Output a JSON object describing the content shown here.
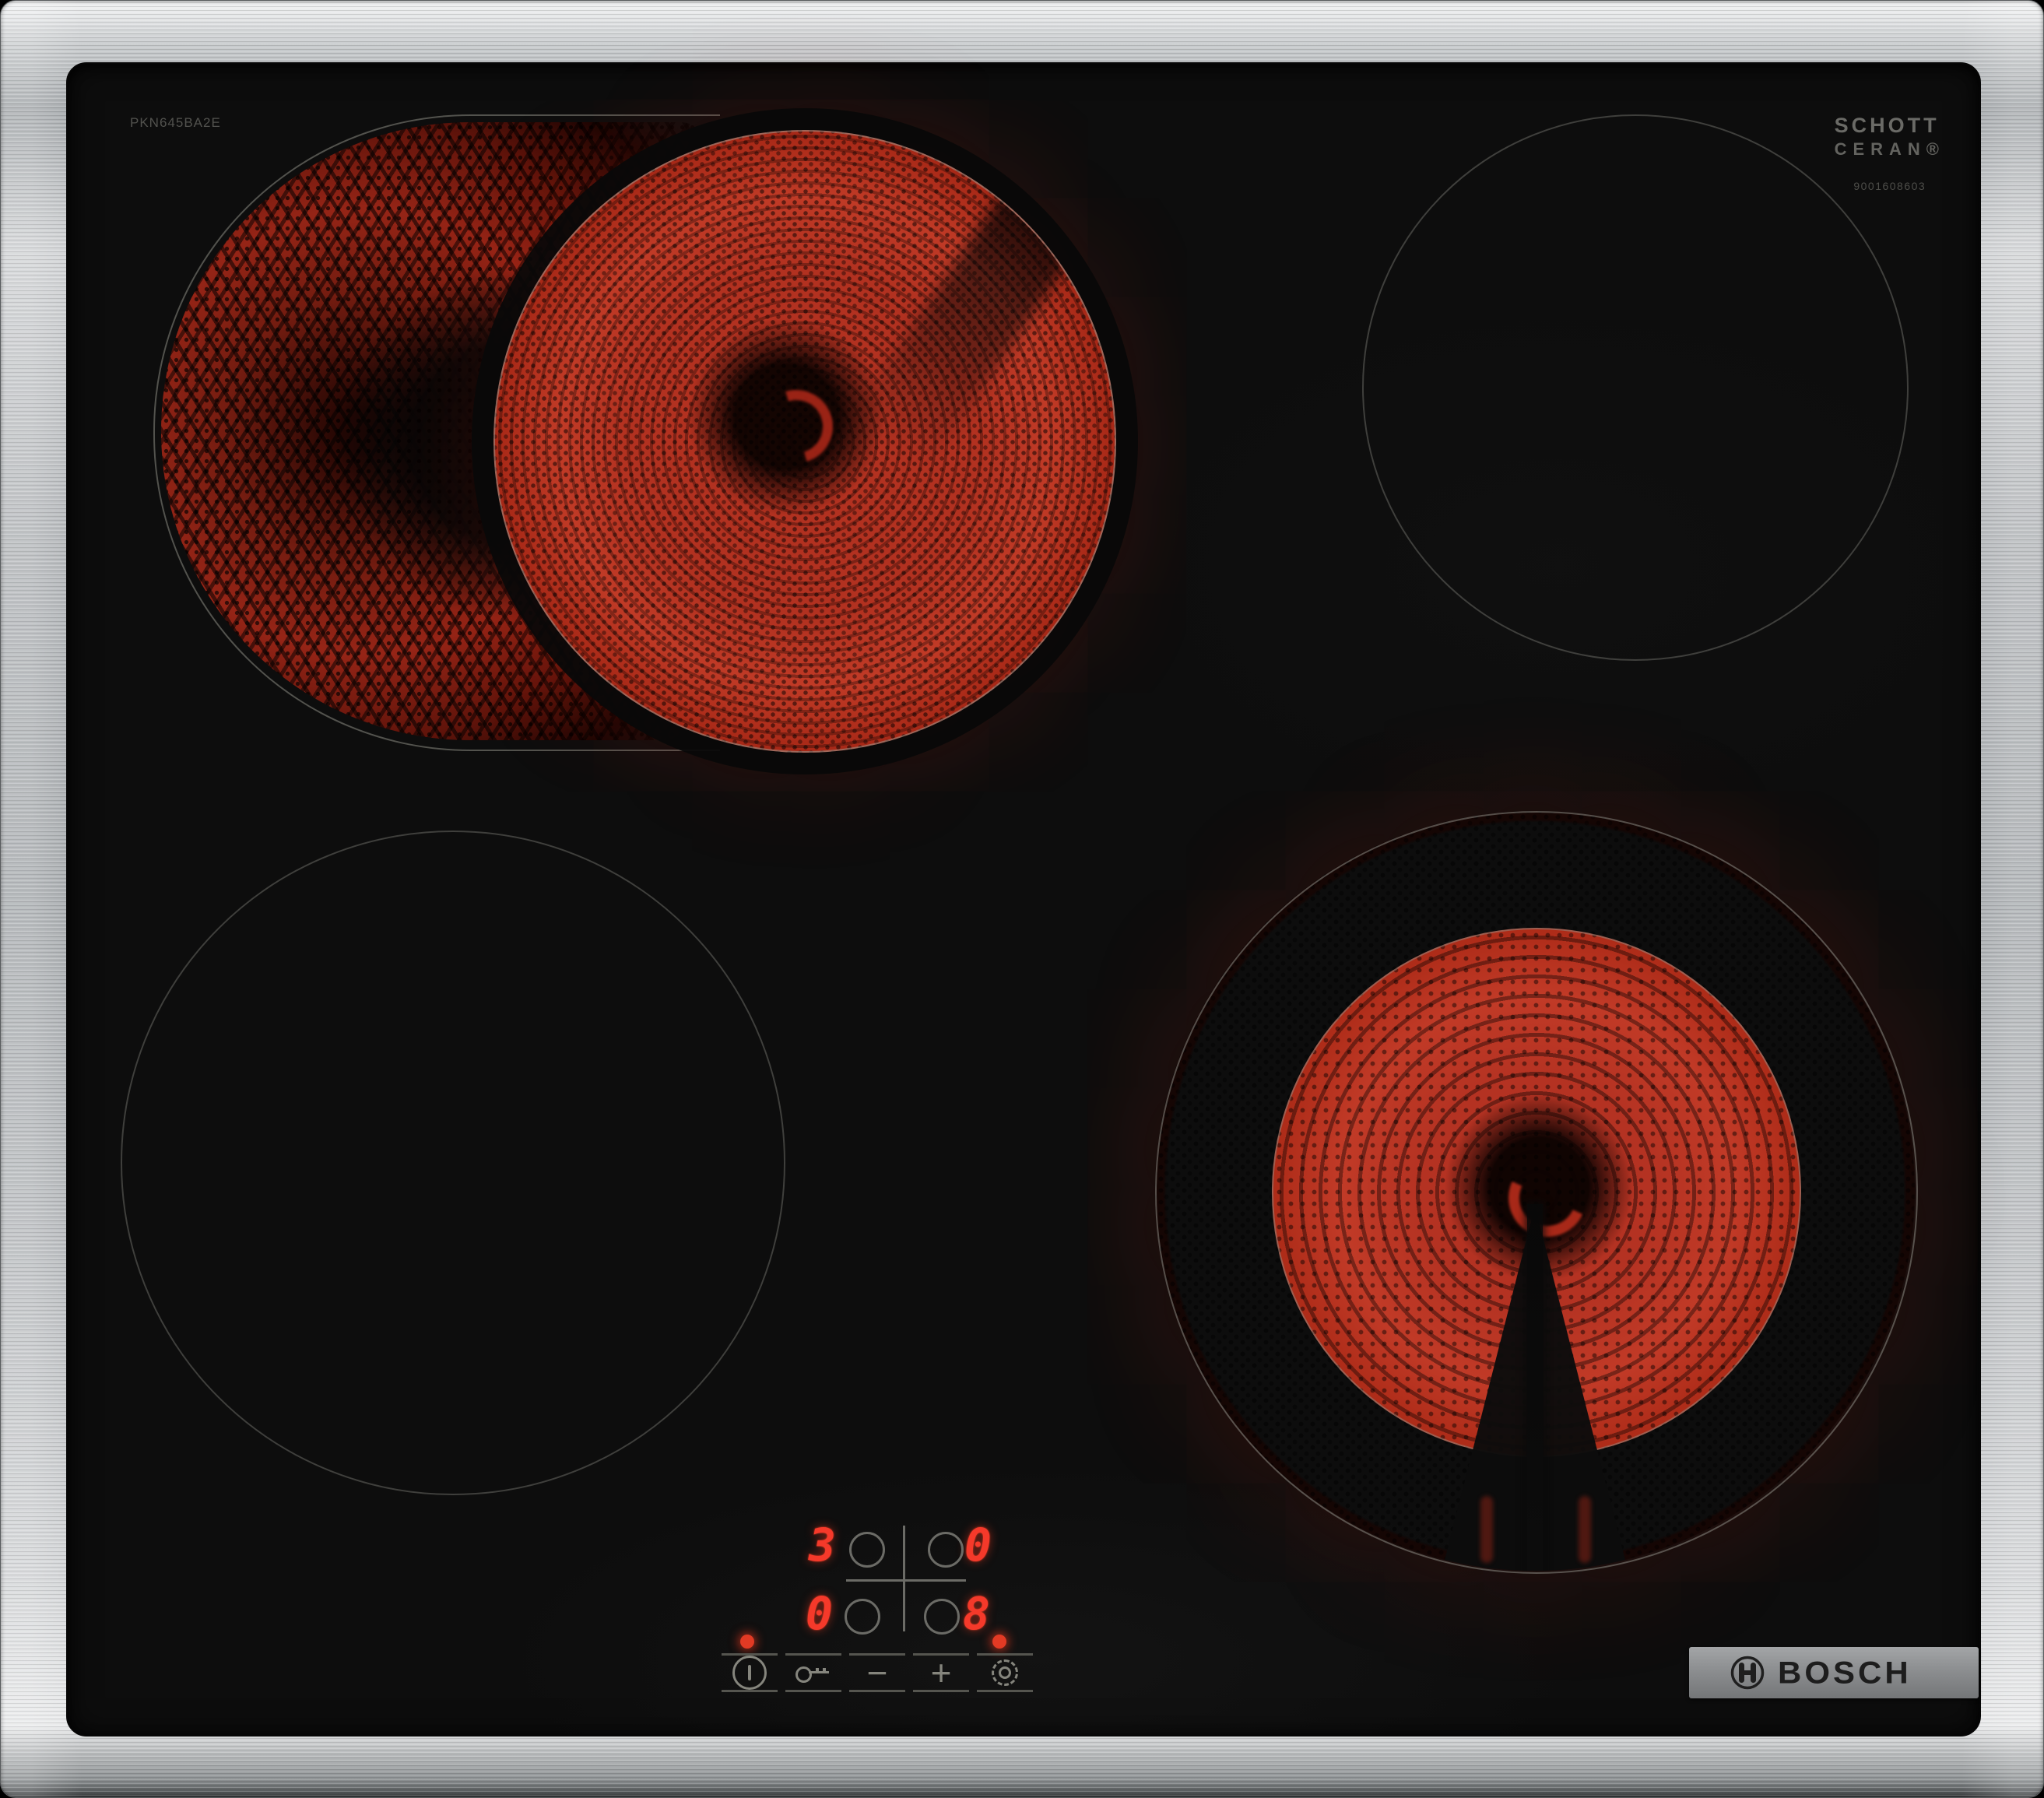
{
  "device": {
    "model": "PKN645BA2E",
    "glass_brand_line1": "SCHOTT",
    "glass_brand_line2": "CERAN®",
    "serial": "9001608603",
    "brand": "BOSCH"
  },
  "display": {
    "zone_levels": {
      "rear_left": "3",
      "rear_right": "0",
      "front_left": "0",
      "front_right": "8"
    }
  },
  "controls": {
    "power": "power-standby",
    "child_lock": "child-lock-key",
    "decrease_label": "−",
    "increase_label": "+",
    "dual_zone": "dual-zone-select",
    "residual_heat_left_on": true,
    "residual_heat_right_on": true
  },
  "burners": {
    "rear_left": {
      "type": "dual-circuit oval zone",
      "state": "on",
      "level": "3"
    },
    "rear_right": {
      "type": "single zone",
      "state": "off",
      "level": "0"
    },
    "front_left": {
      "type": "single zone",
      "state": "off",
      "level": "0"
    },
    "front_right": {
      "type": "dual-ring zone",
      "state": "on",
      "level": "8"
    }
  },
  "colors": {
    "frame_steel": "#b5b8bb",
    "glass": "#0d0d0d",
    "heat_red": "#c03a26",
    "outline_gray": "#4a4a46",
    "digit_red": "#f5392a",
    "indicator_red": "#e23a24"
  }
}
